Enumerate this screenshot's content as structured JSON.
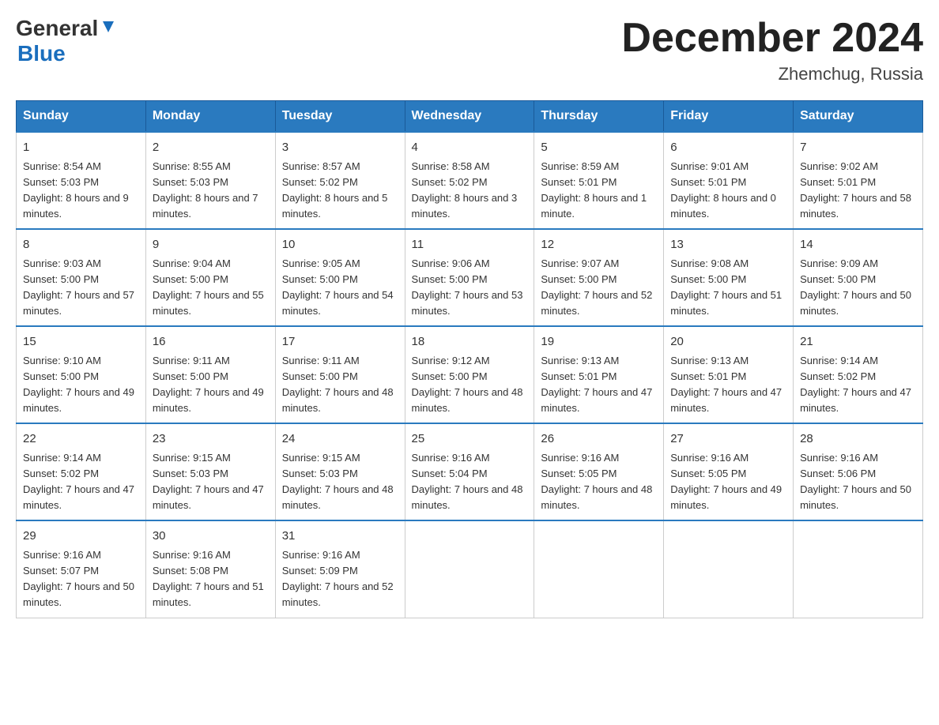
{
  "header": {
    "logo_general": "General",
    "logo_blue": "Blue",
    "month_title": "December 2024",
    "location": "Zhemchug, Russia"
  },
  "days_of_week": [
    "Sunday",
    "Monday",
    "Tuesday",
    "Wednesday",
    "Thursday",
    "Friday",
    "Saturday"
  ],
  "weeks": [
    [
      {
        "date": "1",
        "sunrise": "8:54 AM",
        "sunset": "5:03 PM",
        "daylight": "8 hours and 9 minutes."
      },
      {
        "date": "2",
        "sunrise": "8:55 AM",
        "sunset": "5:03 PM",
        "daylight": "8 hours and 7 minutes."
      },
      {
        "date": "3",
        "sunrise": "8:57 AM",
        "sunset": "5:02 PM",
        "daylight": "8 hours and 5 minutes."
      },
      {
        "date": "4",
        "sunrise": "8:58 AM",
        "sunset": "5:02 PM",
        "daylight": "8 hours and 3 minutes."
      },
      {
        "date": "5",
        "sunrise": "8:59 AM",
        "sunset": "5:01 PM",
        "daylight": "8 hours and 1 minute."
      },
      {
        "date": "6",
        "sunrise": "9:01 AM",
        "sunset": "5:01 PM",
        "daylight": "8 hours and 0 minutes."
      },
      {
        "date": "7",
        "sunrise": "9:02 AM",
        "sunset": "5:01 PM",
        "daylight": "7 hours and 58 minutes."
      }
    ],
    [
      {
        "date": "8",
        "sunrise": "9:03 AM",
        "sunset": "5:00 PM",
        "daylight": "7 hours and 57 minutes."
      },
      {
        "date": "9",
        "sunrise": "9:04 AM",
        "sunset": "5:00 PM",
        "daylight": "7 hours and 55 minutes."
      },
      {
        "date": "10",
        "sunrise": "9:05 AM",
        "sunset": "5:00 PM",
        "daylight": "7 hours and 54 minutes."
      },
      {
        "date": "11",
        "sunrise": "9:06 AM",
        "sunset": "5:00 PM",
        "daylight": "7 hours and 53 minutes."
      },
      {
        "date": "12",
        "sunrise": "9:07 AM",
        "sunset": "5:00 PM",
        "daylight": "7 hours and 52 minutes."
      },
      {
        "date": "13",
        "sunrise": "9:08 AM",
        "sunset": "5:00 PM",
        "daylight": "7 hours and 51 minutes."
      },
      {
        "date": "14",
        "sunrise": "9:09 AM",
        "sunset": "5:00 PM",
        "daylight": "7 hours and 50 minutes."
      }
    ],
    [
      {
        "date": "15",
        "sunrise": "9:10 AM",
        "sunset": "5:00 PM",
        "daylight": "7 hours and 49 minutes."
      },
      {
        "date": "16",
        "sunrise": "9:11 AM",
        "sunset": "5:00 PM",
        "daylight": "7 hours and 49 minutes."
      },
      {
        "date": "17",
        "sunrise": "9:11 AM",
        "sunset": "5:00 PM",
        "daylight": "7 hours and 48 minutes."
      },
      {
        "date": "18",
        "sunrise": "9:12 AM",
        "sunset": "5:00 PM",
        "daylight": "7 hours and 48 minutes."
      },
      {
        "date": "19",
        "sunrise": "9:13 AM",
        "sunset": "5:01 PM",
        "daylight": "7 hours and 47 minutes."
      },
      {
        "date": "20",
        "sunrise": "9:13 AM",
        "sunset": "5:01 PM",
        "daylight": "7 hours and 47 minutes."
      },
      {
        "date": "21",
        "sunrise": "9:14 AM",
        "sunset": "5:02 PM",
        "daylight": "7 hours and 47 minutes."
      }
    ],
    [
      {
        "date": "22",
        "sunrise": "9:14 AM",
        "sunset": "5:02 PM",
        "daylight": "7 hours and 47 minutes."
      },
      {
        "date": "23",
        "sunrise": "9:15 AM",
        "sunset": "5:03 PM",
        "daylight": "7 hours and 47 minutes."
      },
      {
        "date": "24",
        "sunrise": "9:15 AM",
        "sunset": "5:03 PM",
        "daylight": "7 hours and 48 minutes."
      },
      {
        "date": "25",
        "sunrise": "9:16 AM",
        "sunset": "5:04 PM",
        "daylight": "7 hours and 48 minutes."
      },
      {
        "date": "26",
        "sunrise": "9:16 AM",
        "sunset": "5:05 PM",
        "daylight": "7 hours and 48 minutes."
      },
      {
        "date": "27",
        "sunrise": "9:16 AM",
        "sunset": "5:05 PM",
        "daylight": "7 hours and 49 minutes."
      },
      {
        "date": "28",
        "sunrise": "9:16 AM",
        "sunset": "5:06 PM",
        "daylight": "7 hours and 50 minutes."
      }
    ],
    [
      {
        "date": "29",
        "sunrise": "9:16 AM",
        "sunset": "5:07 PM",
        "daylight": "7 hours and 50 minutes."
      },
      {
        "date": "30",
        "sunrise": "9:16 AM",
        "sunset": "5:08 PM",
        "daylight": "7 hours and 51 minutes."
      },
      {
        "date": "31",
        "sunrise": "9:16 AM",
        "sunset": "5:09 PM",
        "daylight": "7 hours and 52 minutes."
      },
      null,
      null,
      null,
      null
    ]
  ]
}
